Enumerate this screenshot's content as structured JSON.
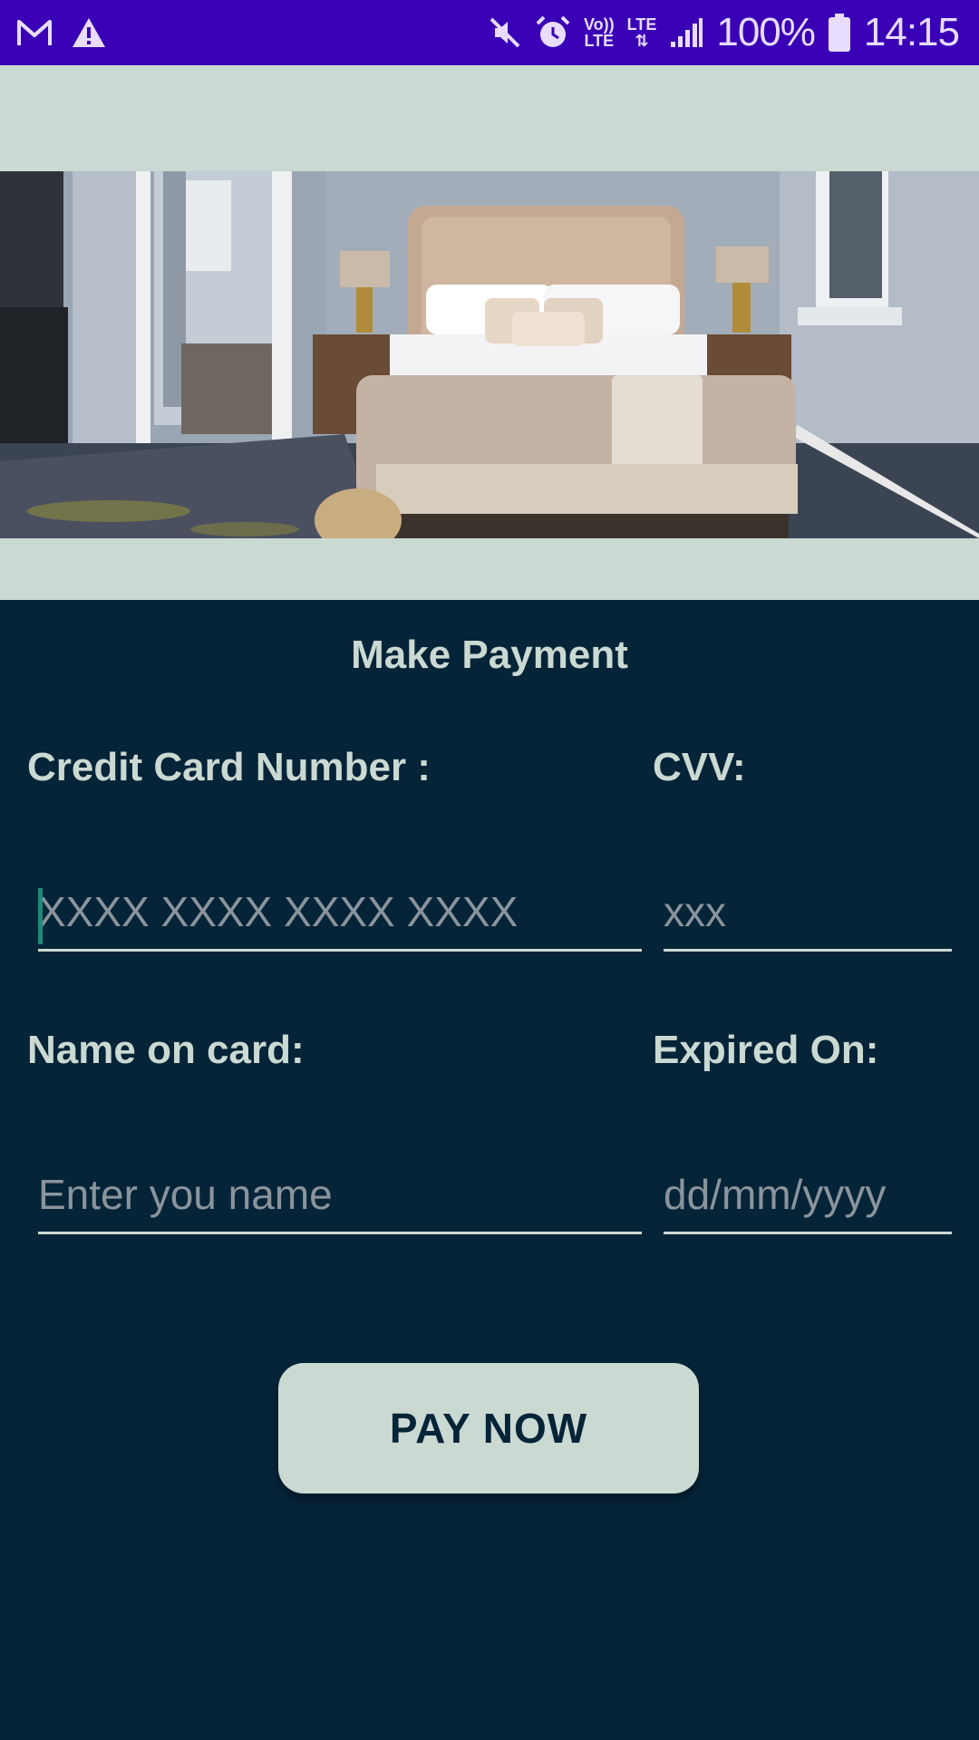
{
  "status_bar": {
    "battery": "100%",
    "time": "14:15",
    "volte_top": "Vo))",
    "volte_bottom": "LTE",
    "lte_label": "LTE",
    "icons": [
      "gmail-icon",
      "warning-icon",
      "mute-icon",
      "alarm-icon",
      "volte-icon",
      "lte-icon",
      "signal-icon",
      "battery-icon"
    ],
    "background_color": "#3a00b6"
  },
  "banner": {
    "image": "bedroom-photo",
    "background_color": "#cad9d2"
  },
  "form": {
    "title": "Make Payment",
    "card_number": {
      "label": "Credit Card Number :",
      "placeholder": "XXXX XXXX XXXX XXXX",
      "value": ""
    },
    "cvv": {
      "label": "CVV:",
      "placeholder": "xxx",
      "value": ""
    },
    "name": {
      "label": "Name on card:",
      "placeholder": "Enter you name",
      "value": ""
    },
    "expiry": {
      "label": "Expired On:",
      "placeholder": "dd/mm/yyyy",
      "value": ""
    },
    "pay_button": "PAY NOW",
    "background_color": "#062438",
    "accent_color": "#cad9d2"
  }
}
